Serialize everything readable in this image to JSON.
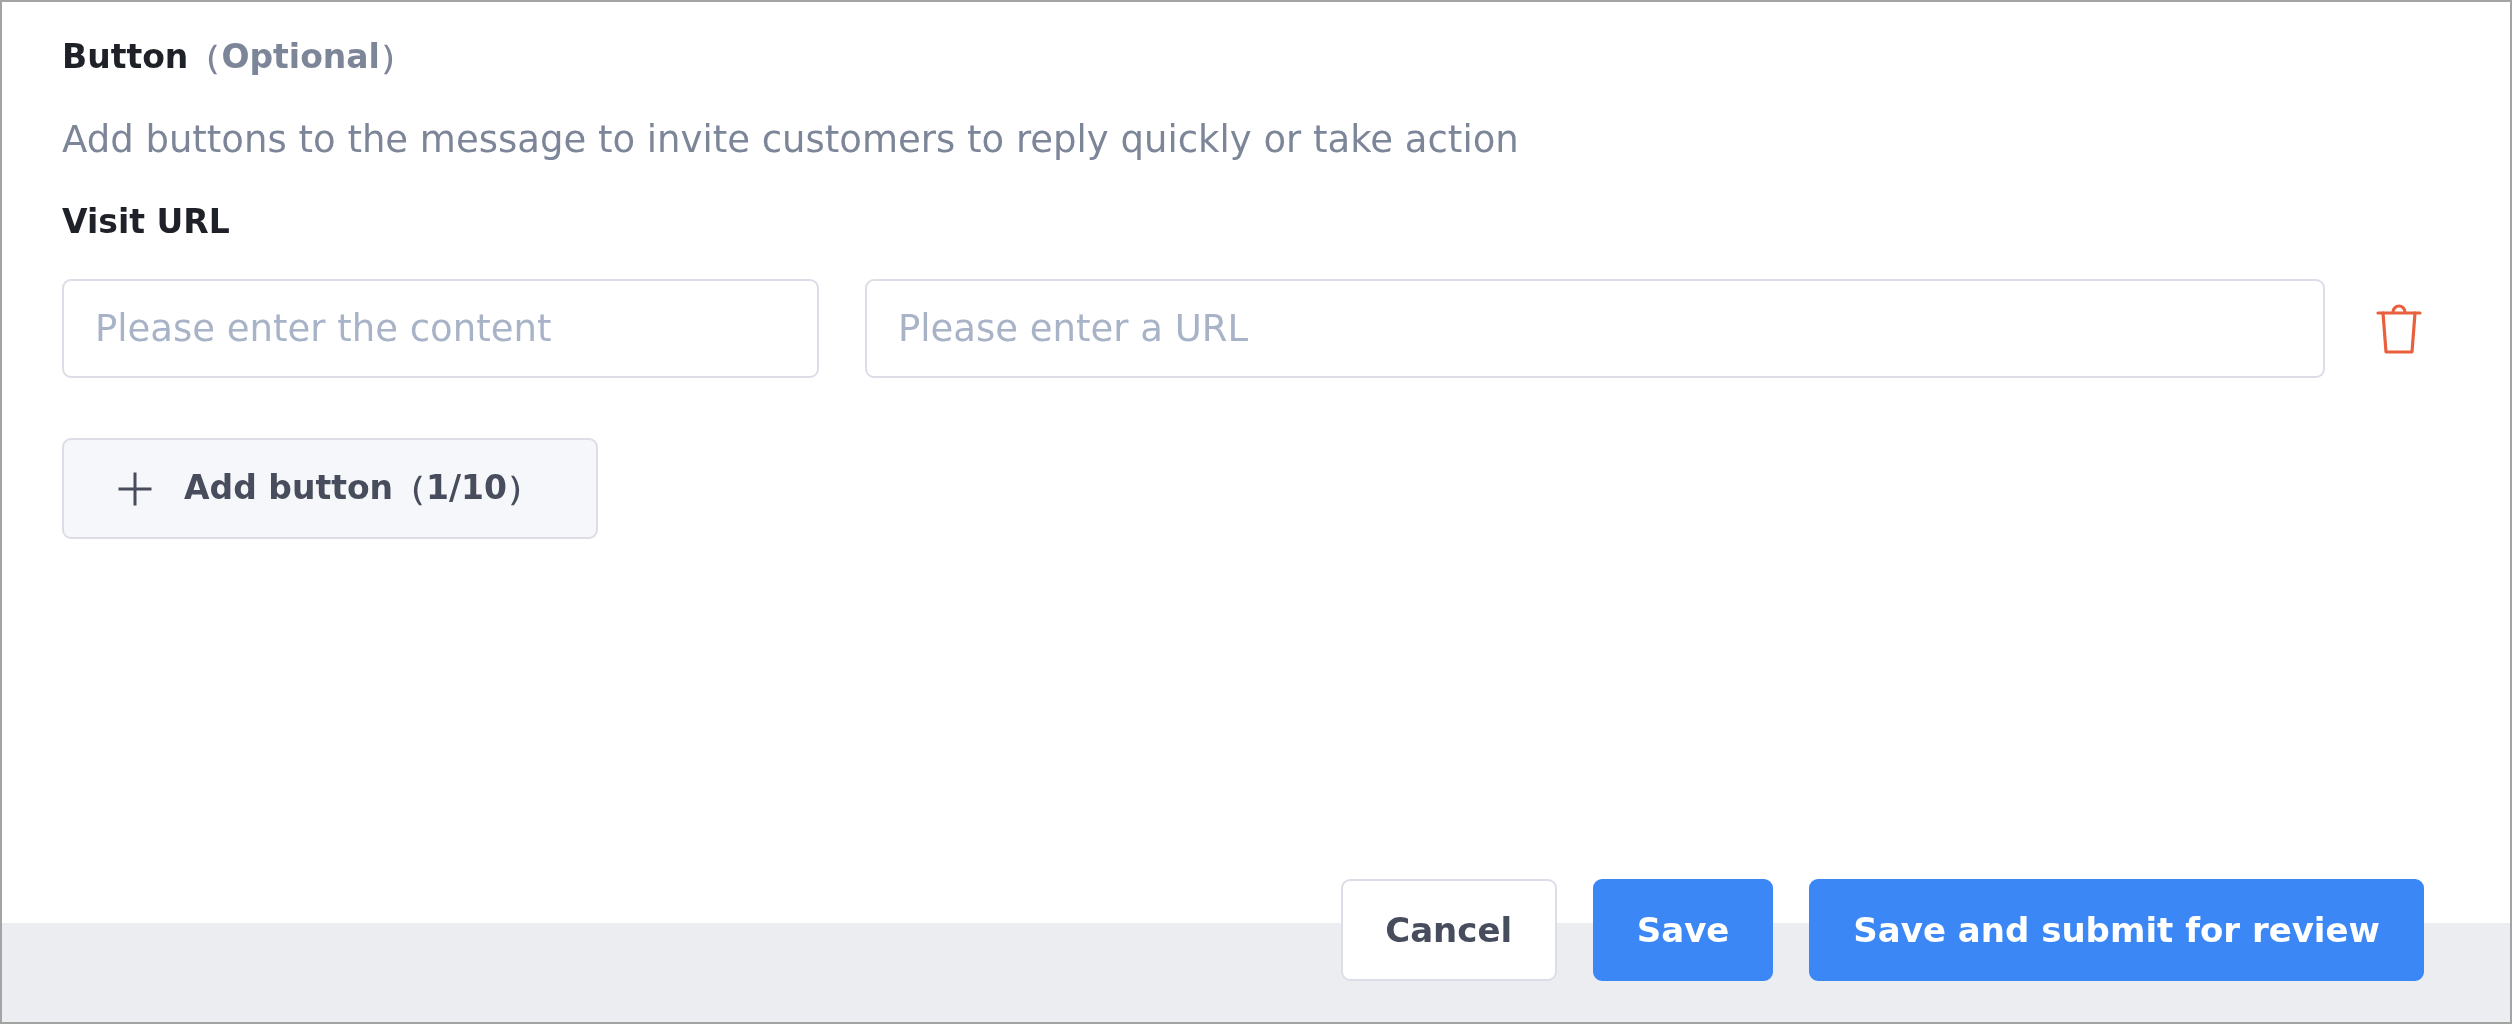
{
  "section": {
    "title": "Button",
    "optional_note": "（Optional）",
    "description": "Add buttons to the message to invite customers to reply quickly or take action"
  },
  "button_type": {
    "label": "Visit URL"
  },
  "fields": [
    {
      "kind": "text",
      "placeholder": "Please enter the content"
    },
    {
      "kind": "url",
      "placeholder": "Please enter a URL"
    }
  ],
  "add_button": {
    "label": "Add button（1/10）"
  },
  "footer": {
    "buttons": [
      {
        "kind": "secondary",
        "label": "Cancel"
      },
      {
        "kind": "primary",
        "label": "Save"
      },
      {
        "kind": "primary",
        "label": "Save and submit for review"
      }
    ]
  }
}
